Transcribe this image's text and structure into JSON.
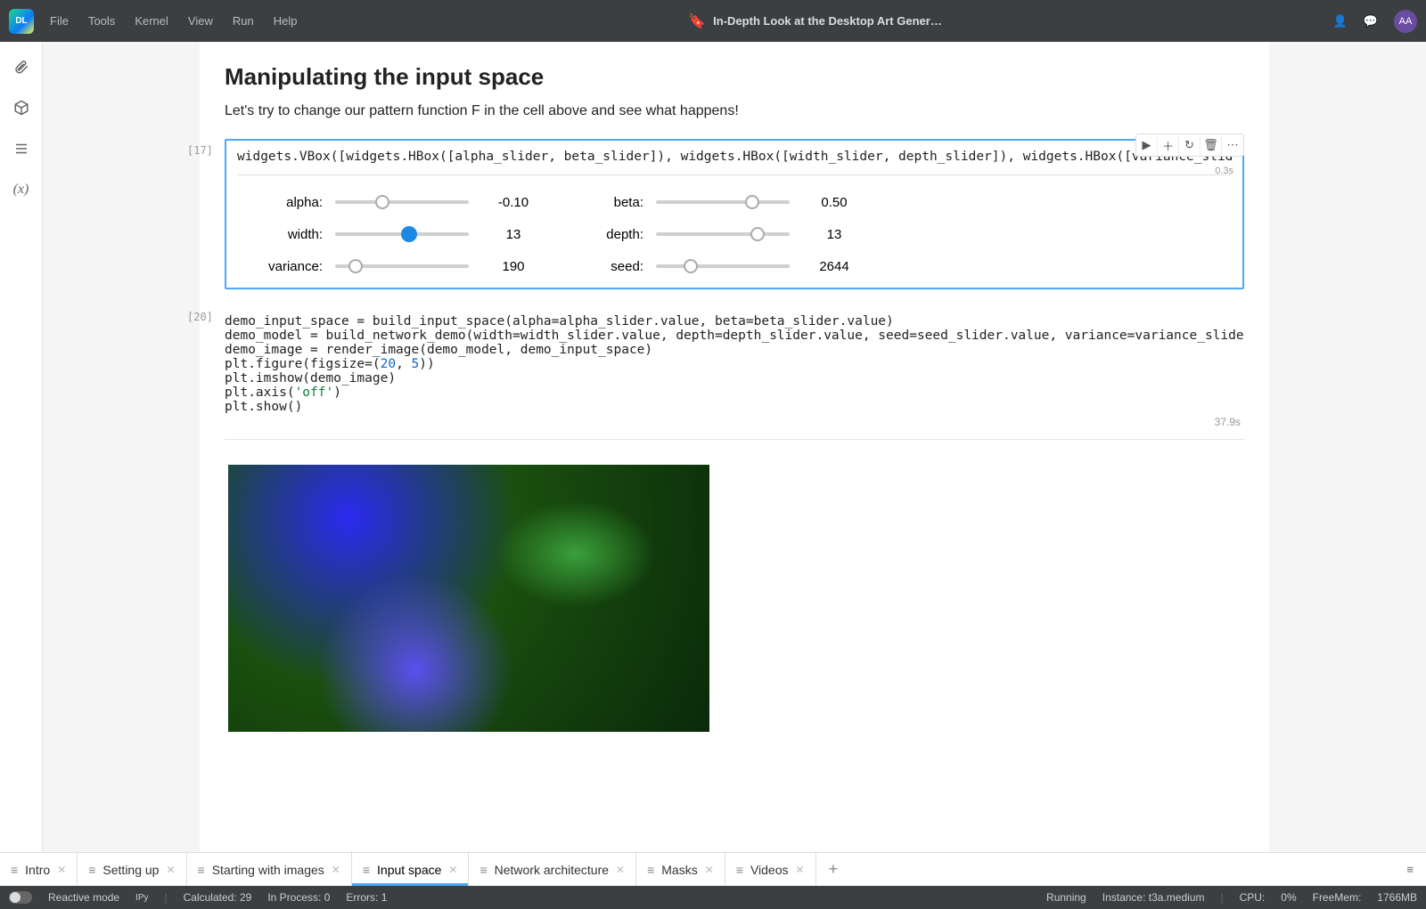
{
  "app": {
    "logo_text": "DL"
  },
  "menu": [
    "File",
    "Tools",
    "Kernel",
    "View",
    "Run",
    "Help"
  ],
  "title": "In-Depth Look at the Desktop Art Gener…",
  "avatar": "AA",
  "markdown": {
    "heading": "Manipulating the input space",
    "text": "Let's try to change our pattern function F in the cell above and see what happens!"
  },
  "cell17": {
    "prompt": "[17]",
    "code": "widgets.VBox([widgets.HBox([alpha_slider, beta_slider]), widgets.HBox([width_slider, depth_slider]), widgets.HBox([variance_slider, se",
    "exec_time": "0.3s",
    "sliders": [
      {
        "label": "alpha:",
        "pos": 35,
        "value": "-0.10",
        "blue": false
      },
      {
        "label": "beta:",
        "pos": 72,
        "value": "0.50",
        "blue": false
      },
      {
        "label": "width:",
        "pos": 55,
        "value": "13",
        "blue": true
      },
      {
        "label": "depth:",
        "pos": 76,
        "value": "13",
        "blue": false
      },
      {
        "label": "variance:",
        "pos": 15,
        "value": "190",
        "blue": false
      },
      {
        "label": "seed:",
        "pos": 26,
        "value": "2644",
        "blue": false
      }
    ]
  },
  "cell20": {
    "prompt": "[20]",
    "code_lines": [
      "demo_input_space = build_input_space(alpha=alpha_slider.value, beta=beta_slider.value)",
      "demo_model = build_network_demo(width=width_slider.value, depth=depth_slider.value, seed=seed_slider.value, variance=variance_slider.v",
      "demo_image = render_image(demo_model, demo_input_space)",
      "plt.figure(figsize=(20, 5))",
      "plt.imshow(demo_image)",
      "plt.axis('off')",
      "plt.show()"
    ],
    "exec_time": "37.9s"
  },
  "tabs": [
    {
      "label": "Intro",
      "active": false
    },
    {
      "label": "Setting up",
      "active": false
    },
    {
      "label": "Starting with images",
      "active": false
    },
    {
      "label": "Input space",
      "active": true
    },
    {
      "label": "Network architecture",
      "active": false
    },
    {
      "label": "Masks",
      "active": false
    },
    {
      "label": "Videos",
      "active": false
    }
  ],
  "status": {
    "reactive": "Reactive mode",
    "ipy": "IPy",
    "calculated": "Calculated: 29",
    "inprocess": "In Process: 0",
    "errors": "Errors: 1",
    "running": "Running",
    "instance": "Instance: t3a.medium",
    "cpu_lbl": "CPU:",
    "cpu_val": "0%",
    "mem_lbl": "FreeMem:",
    "mem_val": "1766MB"
  }
}
